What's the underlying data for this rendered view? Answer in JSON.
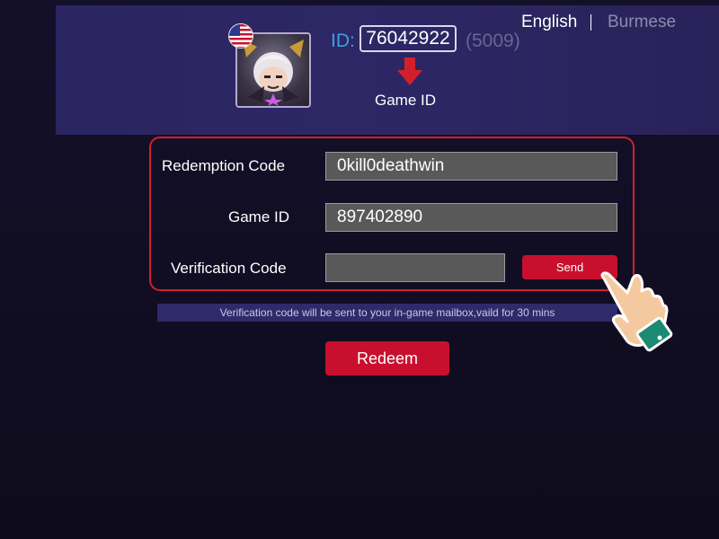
{
  "language": {
    "english": "English",
    "burmese": "Burmese"
  },
  "profile": {
    "id_label": "ID:",
    "id_value": "76042922",
    "server": "(5009)",
    "game_id_caption": "Game ID"
  },
  "form": {
    "redemption_code_label": "Redemption Code",
    "redemption_code_value": "0kill0deathwin",
    "game_id_label": "Game ID",
    "game_id_value": "897402890",
    "verification_code_label": "Verification Code",
    "verification_code_value": "",
    "send_label": "Send",
    "notice": "Verification code will be sent to your in-game mailbox,vaild for 30 mins",
    "redeem_label": "Redeem"
  },
  "colors": {
    "accent_red": "#c8102e",
    "id_blue": "#3aa0e6",
    "header_purple": "#2a2560"
  }
}
